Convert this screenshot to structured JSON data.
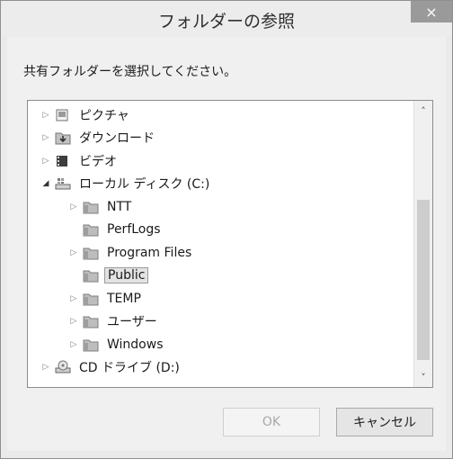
{
  "dialog": {
    "title": "フォルダーの参照",
    "close_glyph": "×",
    "prompt": "共有フォルダーを選択してください。"
  },
  "tree": {
    "items": [
      {
        "label": "ピクチャ",
        "level": 0,
        "expander": "closed",
        "icon": "pictures-library-icon"
      },
      {
        "label": "ダウンロード",
        "level": 0,
        "expander": "closed",
        "icon": "downloads-folder-icon"
      },
      {
        "label": "ビデオ",
        "level": 0,
        "expander": "closed",
        "icon": "videos-library-icon"
      },
      {
        "label": "ローカル ディスク (C:)",
        "level": 0,
        "expander": "open",
        "icon": "local-disk-icon"
      },
      {
        "label": "NTT",
        "level": 1,
        "expander": "closed",
        "icon": "folder-icon"
      },
      {
        "label": "PerfLogs",
        "level": 1,
        "expander": "none",
        "icon": "folder-icon"
      },
      {
        "label": "Program Files",
        "level": 1,
        "expander": "closed",
        "icon": "folder-icon"
      },
      {
        "label": "Public",
        "level": 1,
        "expander": "none",
        "icon": "folder-icon",
        "selected": true
      },
      {
        "label": "TEMP",
        "level": 1,
        "expander": "closed",
        "icon": "folder-icon"
      },
      {
        "label": "ユーザー",
        "level": 1,
        "expander": "closed",
        "icon": "folder-icon"
      },
      {
        "label": "Windows",
        "level": 1,
        "expander": "closed",
        "icon": "folder-icon"
      },
      {
        "label": "CD ドライブ (D:)",
        "level": 0,
        "expander": "closed",
        "icon": "cd-drive-icon"
      }
    ]
  },
  "scrollbar": {
    "up_glyph": "˄",
    "down_glyph": "˅"
  },
  "buttons": {
    "ok_label": "OK",
    "cancel_label": "キャンセル"
  }
}
